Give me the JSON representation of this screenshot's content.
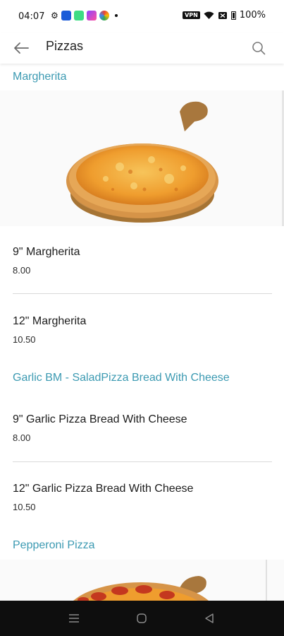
{
  "status_bar": {
    "time": "04:07",
    "battery": "100%",
    "vpn": "VPN"
  },
  "app_bar": {
    "title": "Pizzas"
  },
  "sections": [
    {
      "heading": "Margherita",
      "items": [
        {
          "name": "9\" Margherita",
          "price": "8.00"
        },
        {
          "name": "12\" Margherita",
          "price": "10.50"
        }
      ]
    },
    {
      "heading": "Garlic BM - SaladPizza Bread With Cheese",
      "items": [
        {
          "name": "9\" Garlic Pizza Bread With Cheese",
          "price": "8.00"
        },
        {
          "name": "12\" Garlic Pizza Bread With Cheese",
          "price": "10.50"
        }
      ]
    },
    {
      "heading": "Pepperoni Pizza",
      "items": []
    }
  ],
  "colors": {
    "accent": "#3c9ab2",
    "text": "#1c1c1c",
    "divider": "#d9d9d9",
    "navbar": "#0e0e0e"
  },
  "icons": {
    "back": "arrow-left-icon",
    "search": "search-icon",
    "nav_recents": "menu-lines-icon",
    "nav_home": "circle-home-icon",
    "nav_back": "triangle-back-icon"
  }
}
